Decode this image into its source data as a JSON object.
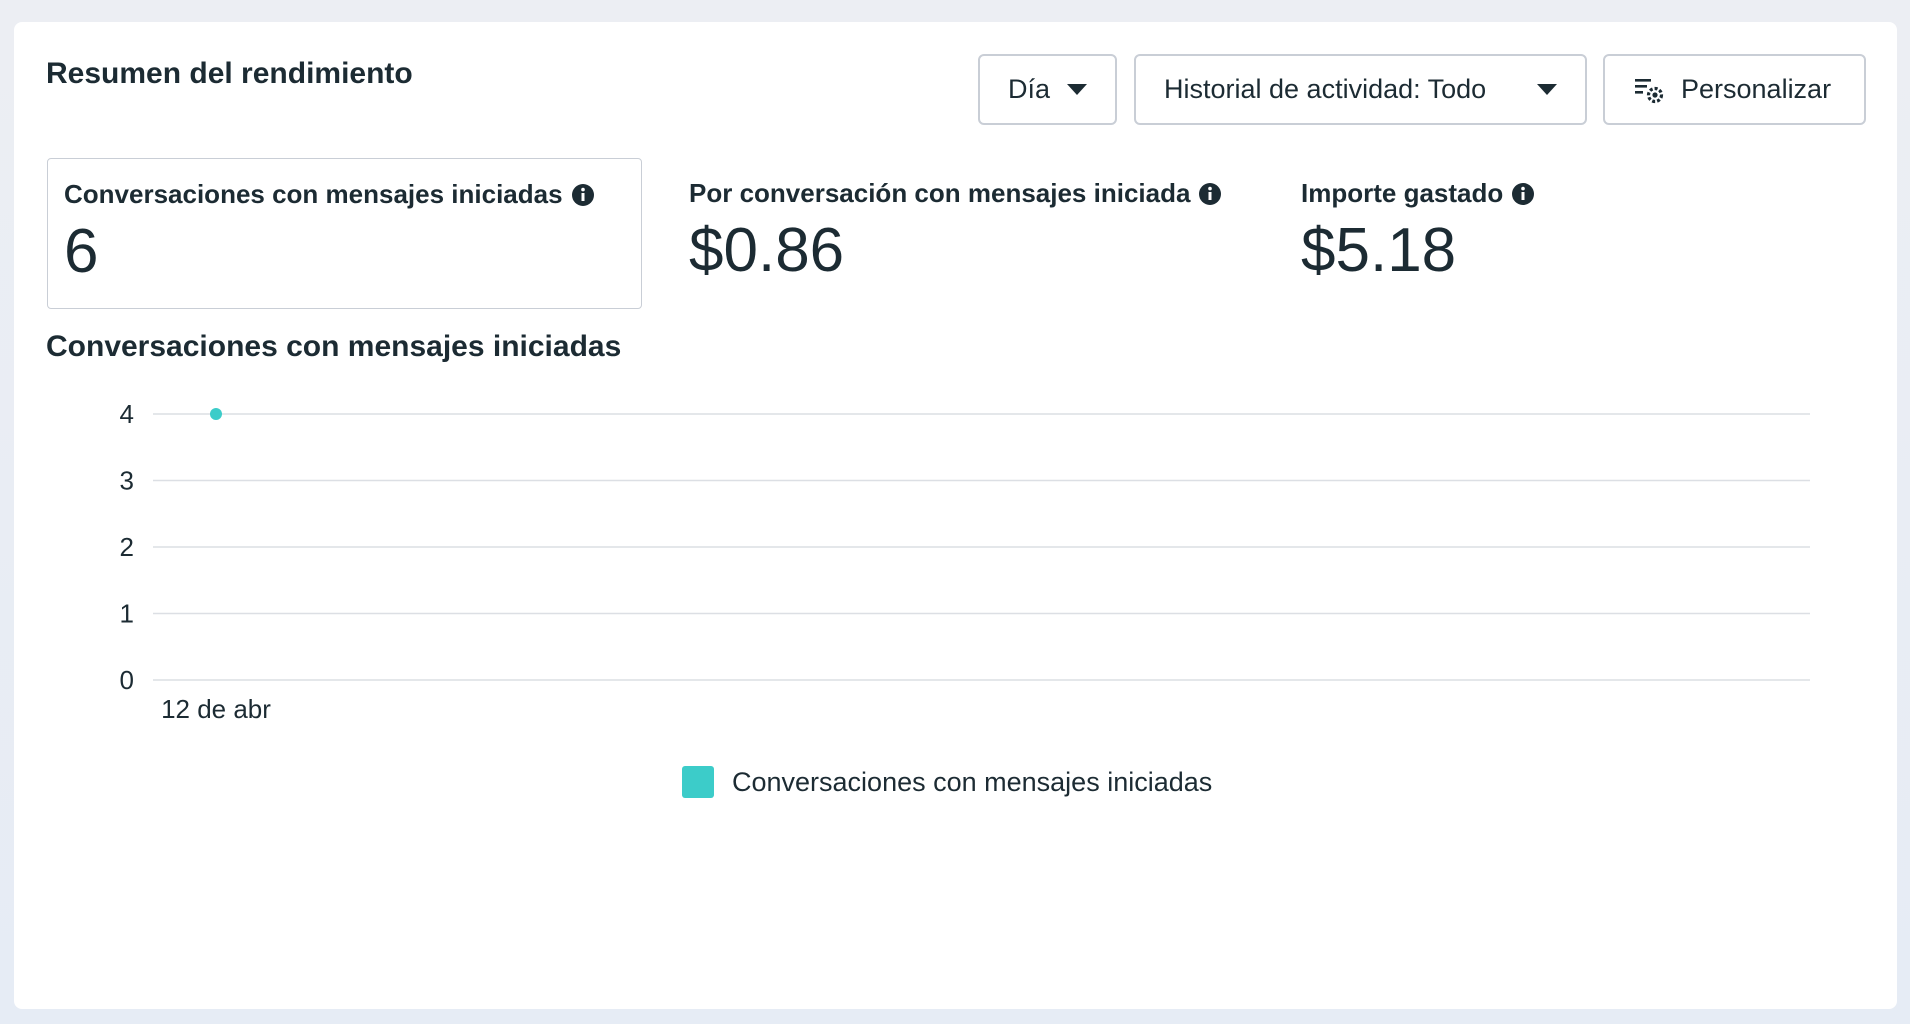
{
  "header": {
    "title": "Resumen del rendimiento"
  },
  "controls": {
    "period_label": "Día",
    "history_label": "Historial de actividad: Todo",
    "customize_label": "Personalizar"
  },
  "metrics": [
    {
      "label": "Conversaciones con mensajes iniciadas",
      "value": "6",
      "selected": true
    },
    {
      "label": "Por conversación con mensajes iniciada",
      "value": "$0.86",
      "selected": false
    },
    {
      "label": "Importe gastado",
      "value": "$5.18",
      "selected": false
    }
  ],
  "icons": {
    "info": "info-icon",
    "customize": "gear-icon",
    "dropdown": "caret-down-icon"
  },
  "colors": {
    "series": "#3cccc9",
    "text": "#1c2b33",
    "grid": "#dcdfe4",
    "border": "#c9ced6"
  },
  "chart_data": {
    "type": "line",
    "title": "Conversaciones con mensajes iniciadas",
    "x": [
      "12 de abr"
    ],
    "series": [
      {
        "name": "Conversaciones con mensajes iniciadas",
        "values": [
          4
        ]
      }
    ],
    "ylim": [
      0,
      4
    ],
    "yticks": [
      0,
      1,
      2,
      3,
      4
    ],
    "grid": true,
    "legend": "bottom-center"
  }
}
